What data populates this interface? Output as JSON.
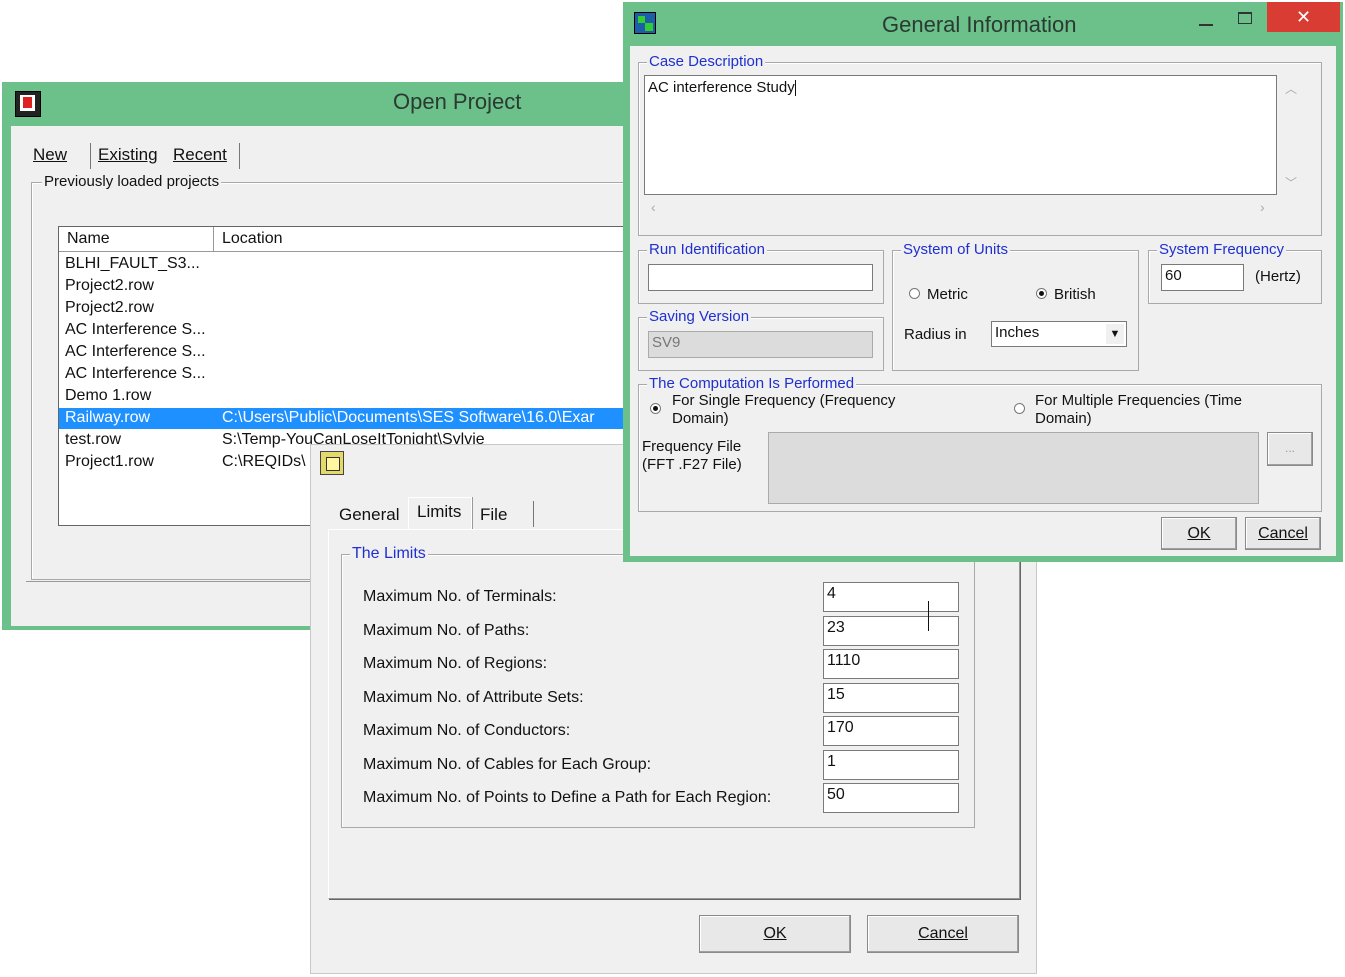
{
  "open_project": {
    "title": "Open Project",
    "tabs": [
      "New",
      "Existing",
      "Recent"
    ],
    "group_label": "Previously loaded projects",
    "columns": [
      "Name",
      "Location"
    ],
    "rows": [
      {
        "name": "BLHI_FAULT_S3...",
        "location": ""
      },
      {
        "name": "Project2.row",
        "location": ""
      },
      {
        "name": "Project2.row",
        "location": ""
      },
      {
        "name": "AC Interference S...",
        "location": ""
      },
      {
        "name": "AC Interference S...",
        "location": ""
      },
      {
        "name": "AC Interference S...",
        "location": ""
      },
      {
        "name": "Demo 1.row",
        "location": ""
      },
      {
        "name": "Railway.row",
        "location": "C:\\Users\\Public\\Documents\\SES Software\\16.0\\Exar"
      },
      {
        "name": "test.row",
        "location": "S:\\Temp-YouCanLoseItTonight\\Sylvie"
      },
      {
        "name": "Project1.row",
        "location": "C:\\REQIDs\\"
      }
    ],
    "selected_row": 7
  },
  "limits_dialog": {
    "tabs": [
      "General",
      "Limits",
      "File"
    ],
    "active_tab": "Limits",
    "group_label": "The Limits",
    "fields": [
      {
        "label": "Maximum No. of Terminals:",
        "value": "4"
      },
      {
        "label": "Maximum No. of Paths:",
        "value": "23"
      },
      {
        "label": "Maximum No. of Regions:",
        "value": "1110"
      },
      {
        "label": "Maximum No. of Attribute Sets:",
        "value": "15"
      },
      {
        "label": "Maximum No. of Conductors:",
        "value": "170"
      },
      {
        "label": "Maximum No. of Cables for Each Group:",
        "value": "1"
      },
      {
        "label": "Maximum No. of Points to Define a Path for Each Region:",
        "value": "50"
      }
    ],
    "ok_label": "OK",
    "cancel_label": "Cancel"
  },
  "general_info": {
    "title": "General Information",
    "case_description_label": "Case Description",
    "case_description_value": "AC interference Study",
    "run_identification_label": "Run Identification",
    "run_identification_value": "",
    "saving_version_label": "Saving Version",
    "saving_version_value": "SV9",
    "units_label": "System of Units",
    "metric_label": "Metric",
    "british_label": "British",
    "radius_label": "Radius in",
    "radius_value": "Inches",
    "frequency_label": "System Frequency",
    "frequency_value": "60",
    "frequency_unit": "(Hertz)",
    "computation_label": "The Computation Is Performed",
    "single_freq_line1": "For Single Frequency (Frequency",
    "single_freq_line2": "Domain)",
    "multi_freq_line1": "For Multiple Frequencies (Time",
    "multi_freq_line2": "Domain)",
    "freq_file_line1": "Frequency File",
    "freq_file_line2": "(FFT .F27 File)",
    "browse_label": "...",
    "ok_label": "OK",
    "cancel_label": "Cancel"
  },
  "colors": {
    "frame": "#6cc08a",
    "selection": "#1e90ff",
    "group_label": "#1f2fd0"
  }
}
